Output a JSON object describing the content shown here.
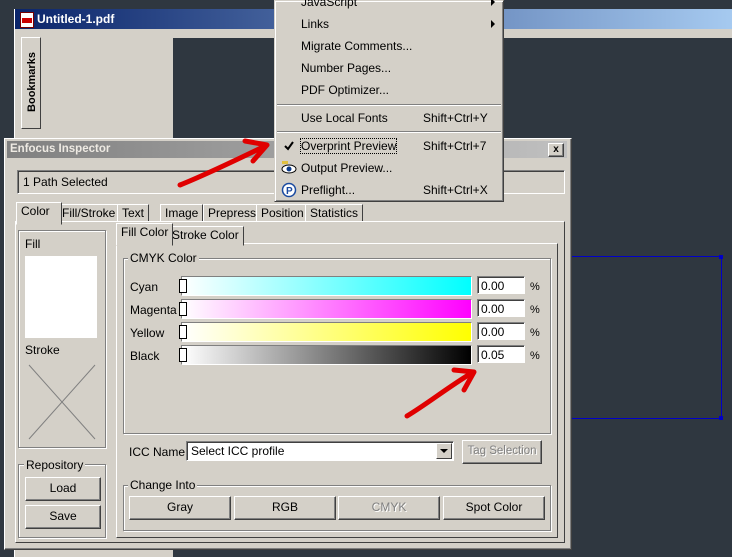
{
  "document": {
    "title": "Untitled-1.pdf",
    "bookmarks_tab": "Bookmarks"
  },
  "menu": {
    "items": [
      {
        "label": "JavaScript",
        "shortcut": "",
        "submenu": true
      },
      {
        "label": "Links",
        "shortcut": "",
        "submenu": true
      },
      {
        "label": "Migrate Comments...",
        "shortcut": ""
      },
      {
        "label": "Number Pages...",
        "shortcut": ""
      },
      {
        "label": "PDF Optimizer...",
        "shortcut": ""
      },
      {
        "label": "Use Local Fonts",
        "shortcut": "Shift+Ctrl+Y"
      },
      {
        "label": "Overprint Preview",
        "shortcut": "Shift+Ctrl+7",
        "checked": true
      },
      {
        "label": "Output Preview...",
        "shortcut": ""
      },
      {
        "label": "Preflight...",
        "shortcut": "Shift+Ctrl+X"
      }
    ]
  },
  "inspector": {
    "title": "Enfocus Inspector",
    "close": "x",
    "status": "1 Path Selected",
    "tabs": [
      "Color",
      "Fill/Stroke",
      "Text",
      "Image",
      "Prepress",
      "Position",
      "Statistics"
    ],
    "active_tab": "Color",
    "fill_label": "Fill",
    "stroke_label": "Stroke",
    "repository": {
      "legend": "Repository",
      "load": "Load",
      "save": "Save"
    },
    "subtabs": [
      "Fill Color",
      "Stroke Color"
    ],
    "active_subtab": "Fill Color",
    "cmyk": {
      "legend": "CMYK Color",
      "channels": [
        {
          "name": "Cyan",
          "value": "0.00",
          "color": "#00ffff"
        },
        {
          "name": "Magenta",
          "value": "0.00",
          "color": "#ff00ff"
        },
        {
          "name": "Yellow",
          "value": "0.00",
          "color": "#ffff00"
        },
        {
          "name": "Black",
          "value": "0.05",
          "color": "#000000"
        }
      ],
      "unit": "%"
    },
    "icc": {
      "label": "ICC Name:",
      "value": "Select ICC profile",
      "tag_button": "Tag Selection"
    },
    "change_into": {
      "legend": "Change Into",
      "buttons": [
        "Gray",
        "RGB",
        "CMYK",
        "Spot Color"
      ]
    }
  },
  "colors": {
    "annotation_arrow": "#e00000",
    "selection": "#0000c8"
  }
}
